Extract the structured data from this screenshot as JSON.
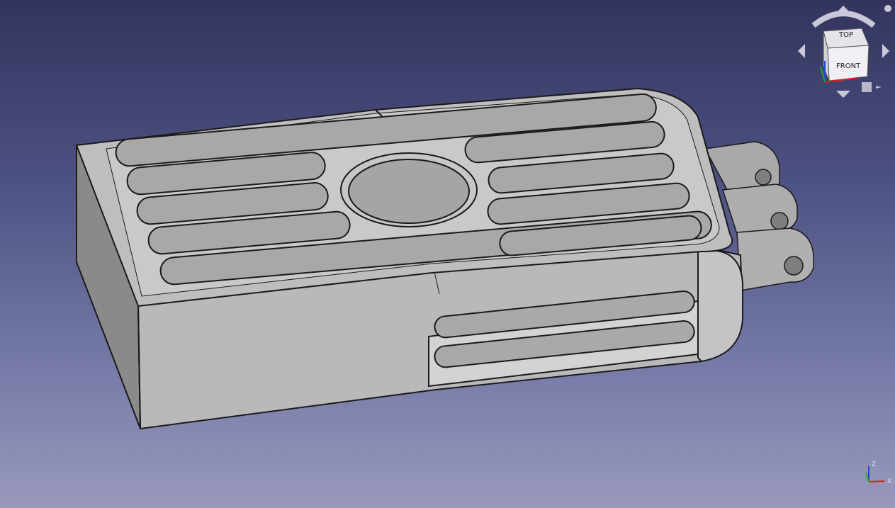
{
  "navigation_cube": {
    "top_face": "TOP",
    "front_face": "FRONT"
  },
  "axis_indicator": {
    "z_label": "Z",
    "x_label": "X"
  },
  "colors": {
    "part_face": "#b4b4b4",
    "part_edge": "#1a1a1a",
    "background_top": "#33345e",
    "background_bottom": "#9899bb"
  }
}
